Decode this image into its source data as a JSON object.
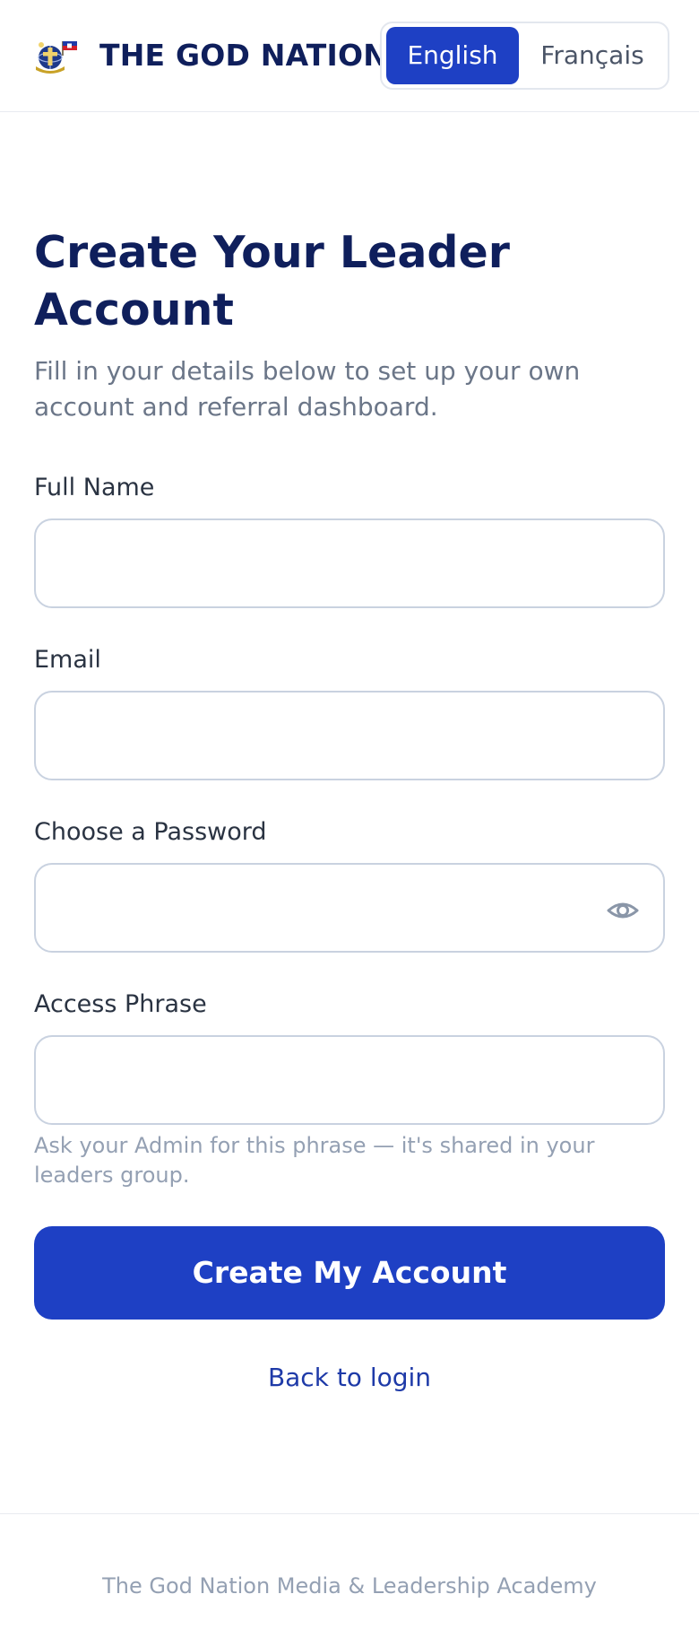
{
  "header": {
    "brand": "THE GOD NATION",
    "logo_icon": "god-nation-logo",
    "languages": [
      {
        "label": "English",
        "active": true
      },
      {
        "label": "Français",
        "active": false
      }
    ]
  },
  "form": {
    "title": "Create Your Leader Account",
    "subtitle": "Fill in your details below to set up your own account and referral dashboard.",
    "fields": {
      "full_name": {
        "label": "Full Name",
        "value": ""
      },
      "email": {
        "label": "Email",
        "value": ""
      },
      "password": {
        "label": "Choose a Password",
        "value": "",
        "toggle_icon": "eye-icon"
      },
      "access_phrase": {
        "label": "Access Phrase",
        "value": "",
        "hint": "Ask your Admin for this phrase — it's shared in your leaders group."
      }
    },
    "submit_label": "Create My Account",
    "back_link": "Back to login"
  },
  "footer": {
    "text": "The God Nation Media & Leadership Academy"
  },
  "colors": {
    "primary": "#1e40c4",
    "navy": "#0f1f5c",
    "muted": "#94a0b3",
    "border": "#c9d2e0"
  }
}
